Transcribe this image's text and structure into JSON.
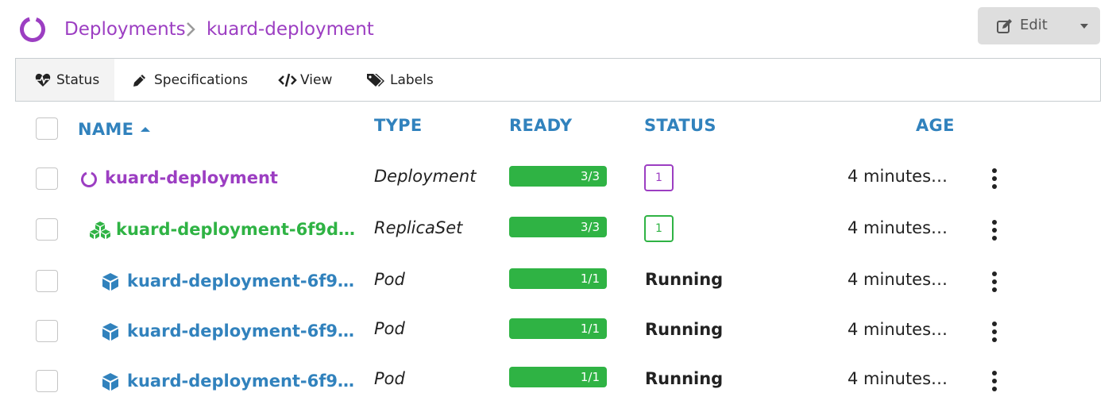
{
  "header": {
    "breadcrumb_root": "Deployments",
    "breadcrumb_current": "kuard-deployment",
    "edit_label": "Edit"
  },
  "tabs": [
    {
      "label": "Status",
      "icon": "heartbeat-icon",
      "active": true
    },
    {
      "label": "Specifications",
      "icon": "pencil-icon",
      "active": false
    },
    {
      "label": "View",
      "icon": "code-icon",
      "active": false
    },
    {
      "label": "Labels",
      "icon": "tags-icon",
      "active": false
    }
  ],
  "table": {
    "columns": {
      "name": "NAME",
      "type": "TYPE",
      "ready": "READY",
      "status": "STATUS",
      "age": "AGE"
    },
    "sort": {
      "column": "name",
      "direction": "ascending"
    },
    "rows": [
      {
        "name": "kuard-deployment",
        "type": "Deployment",
        "ready": "3/3",
        "status": "1",
        "age": "4 minutes…",
        "icon": "deployment-circle-icon"
      },
      {
        "name": "kuard-deployment-6f9d…",
        "type": "ReplicaSet",
        "ready": "3/3",
        "status": "1",
        "age": "4 minutes…",
        "icon": "replicaset-cubes-icon"
      },
      {
        "name": "kuard-deployment-6f9…",
        "type": "Pod",
        "ready": "1/1",
        "status": "Running",
        "age": "4 minutes…",
        "icon": "pod-cube-icon"
      },
      {
        "name": "kuard-deployment-6f9…",
        "type": "Pod",
        "ready": "1/1",
        "status": "Running",
        "age": "4 minutes…",
        "icon": "pod-cube-icon"
      },
      {
        "name": "kuard-deployment-6f9…",
        "type": "Pod",
        "ready": "1/1",
        "status": "Running",
        "age": "4 minutes…",
        "icon": "pod-cube-icon"
      }
    ]
  },
  "colors": {
    "deployment": "#9c3ec2",
    "replicaset": "#2fb344",
    "pod": "#3182bd",
    "ready_bar": "#2fb344",
    "header_text": "#3182bd"
  }
}
